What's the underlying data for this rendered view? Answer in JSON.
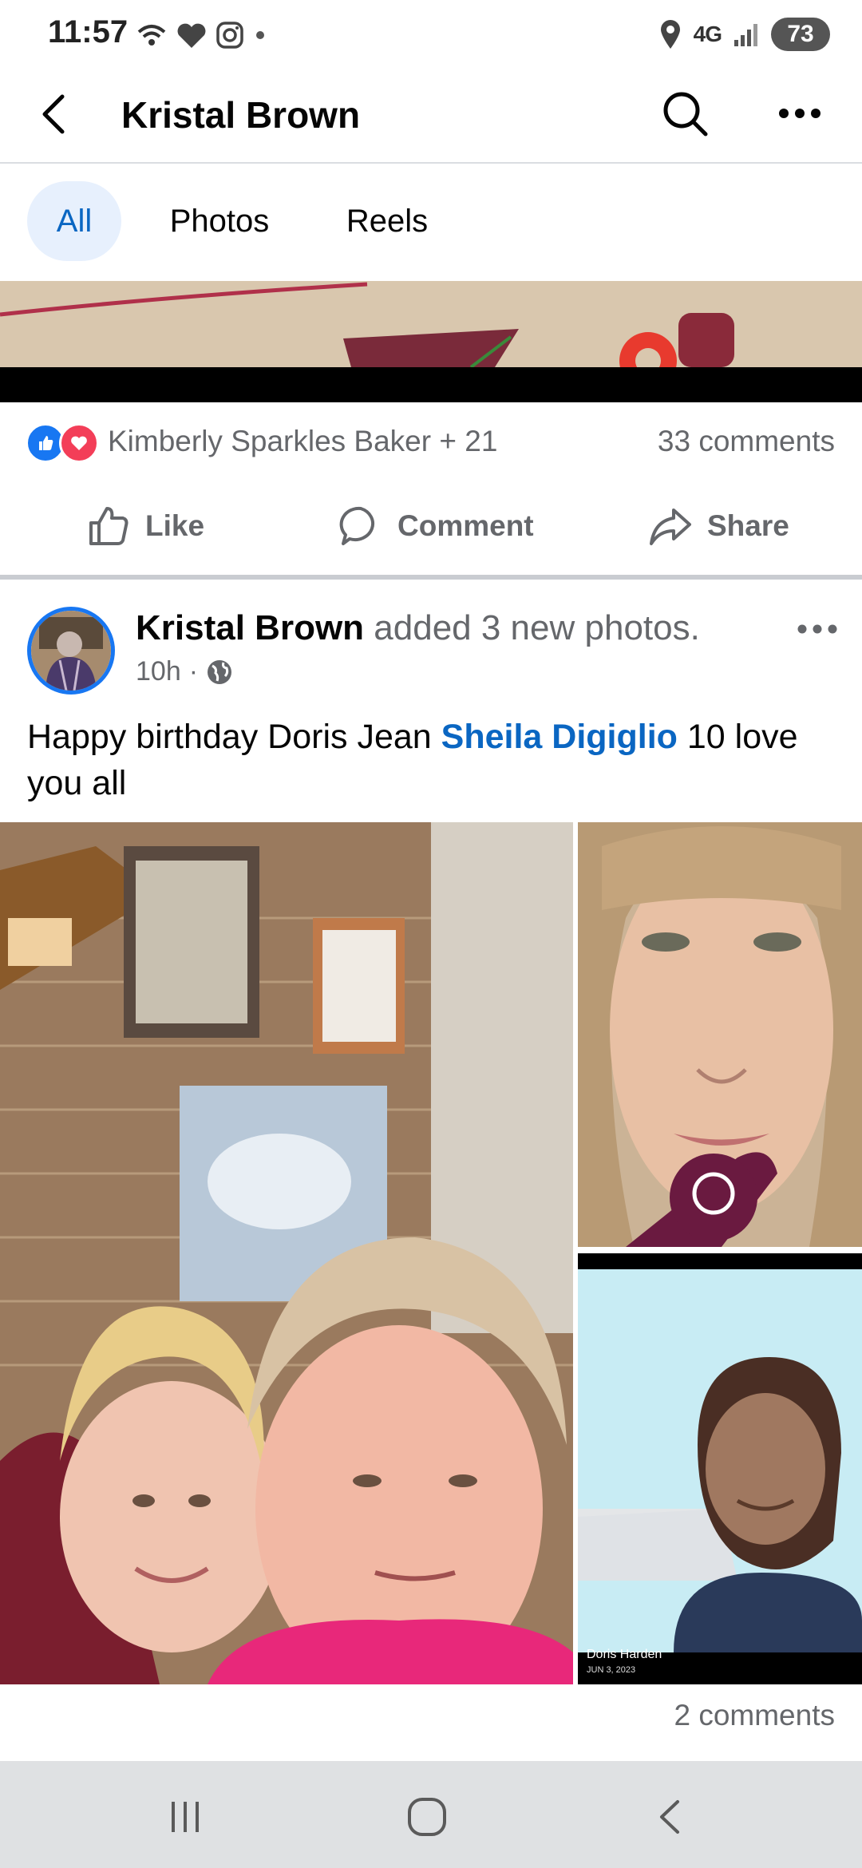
{
  "status_bar": {
    "time": "11:57",
    "network": "4G",
    "network_sub": "LTE",
    "battery": "73"
  },
  "header": {
    "title": "Kristal Brown"
  },
  "tabs": [
    {
      "label": "All",
      "selected": true
    },
    {
      "label": "Photos",
      "selected": false
    },
    {
      "label": "Reels",
      "selected": false
    }
  ],
  "previous_post": {
    "reactions_names": "Kimberly Sparkles Baker + 21",
    "comments": "33 comments",
    "actions": {
      "like": "Like",
      "comment": "Comment",
      "share": "Share"
    }
  },
  "post": {
    "author": "Kristal Brown",
    "action_text": "added 3 new photos.",
    "time": "10h",
    "privacy": "globe-icon",
    "text_before": "Happy birthday Doris Jean ",
    "mention": "Sheila Digiglio",
    "text_after": " 10 love you all",
    "photo_caption_name": "Doris Harden",
    "photo_caption_date": "JUN 3, 2023",
    "comments": "2 comments"
  },
  "colors": {
    "facebook_blue": "#1877f2",
    "link_blue": "#0a66c2",
    "secondary_text": "#65676b",
    "love_red": "#f33e58"
  }
}
